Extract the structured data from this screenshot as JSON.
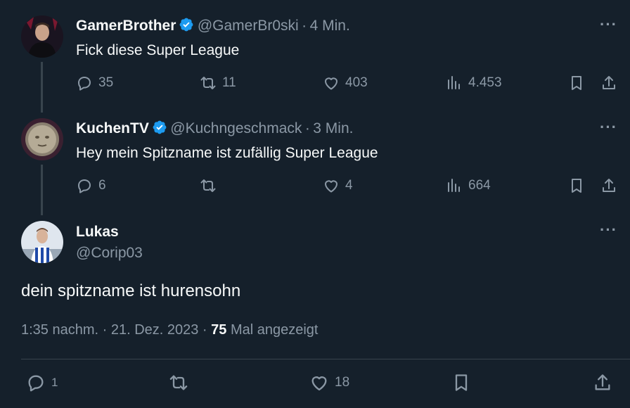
{
  "tweets": [
    {
      "name": "GamerBrother",
      "handle": "@GamerBr0ski",
      "time": "4 Min.",
      "text": "Fick diese Super League",
      "replies": "35",
      "retweets": "11",
      "likes": "403",
      "views": "4.453"
    },
    {
      "name": "KuchenTV",
      "handle": "@Kuchngeschmack",
      "time": "3 Min.",
      "text": "Hey mein Spitzname ist zufällig Super League",
      "replies": "6",
      "retweets": "",
      "likes": "4",
      "views": "664"
    }
  ],
  "main": {
    "name": "Lukas",
    "handle": "@Corip03",
    "text": "dein spitzname ist hurensohn",
    "timestamp": "1:35 nachm. · 21. Dez. 2023 ·",
    "views_count": "75",
    "views_label": "Mal angezeigt",
    "replies": "1",
    "retweets": "",
    "likes": "18"
  },
  "separator": "·",
  "more_glyph": "···",
  "colors": {
    "background": "#15202b",
    "verified": "#1d9bf0",
    "muted": "#8b98a5",
    "divider": "#38444d"
  }
}
